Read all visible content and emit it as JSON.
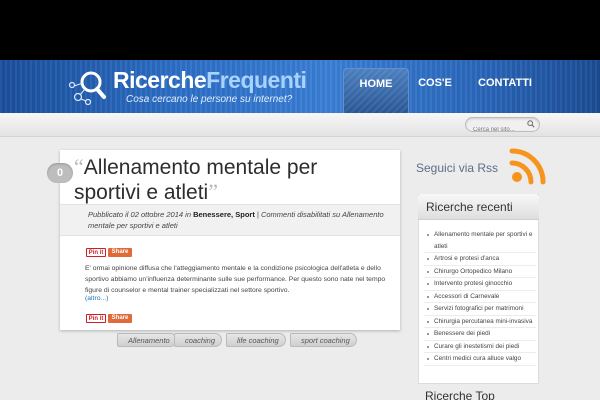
{
  "site": {
    "title_part1": "Ricerche",
    "title_part2": "Frequenti",
    "tagline": "Cosa cercano le persone su internet?",
    "logo_icon": "magnifier-network-icon"
  },
  "nav": {
    "items": [
      {
        "label": "HOME",
        "active": true
      },
      {
        "label": "COS'E",
        "active": false
      },
      {
        "label": "CONTATTI",
        "active": false
      }
    ]
  },
  "search": {
    "placeholder": "Cerca nel sito..."
  },
  "post": {
    "comment_count": "0",
    "title_line1": "Allenamento mentale per",
    "title_line2": "sportivi e atleti",
    "meta_prefix": "Pubblicato il 02 ottobre 2014 in",
    "meta_cat1": "Benessere",
    "meta_sep": ",",
    "meta_cat2": "Sport",
    "meta_suffix": "| Commenti disabilitati su Allenamento mentale per sportivi e atleti",
    "excerpt": "E' ormai opinione diffusa che l'atteggiamento mentale e la condizione psicologica dell'atleta e dello sportivo abbiamo un'influenza determinante sulle sue performance. Per questo sono nate nel tempo figure di counselor e mental trainer specializzati nel settore sportivo.",
    "more_link": "(altro...)",
    "pinit_label": "Pin it",
    "share_label": "Share",
    "tags": [
      "Allenamento",
      "coaching",
      "life coaching",
      "sport coaching"
    ]
  },
  "sidebar": {
    "rss_label": "Seguici via Rss",
    "recent_title": "Ricerche recenti",
    "recent_items": [
      "Allenamento mentale per sportivi e atleti",
      "Artrosi e protesi d'anca",
      "Chirurgo Ortopedico Milano",
      "Intervento protesi ginocchio",
      "Accessori di Carnevale",
      "Servizi fotografici per matrimoni",
      "Chirurgia percutanea mini-invasiva",
      "Benessere dei piedi",
      "Curare gli inestetismi dei piedi",
      "Centri medici cura alluce valgo"
    ],
    "top_title": "Ricerche Top"
  },
  "colors": {
    "header_blue": "#2d6fc7",
    "link_blue": "#1e73be",
    "rss_orange": "#f7941d"
  }
}
